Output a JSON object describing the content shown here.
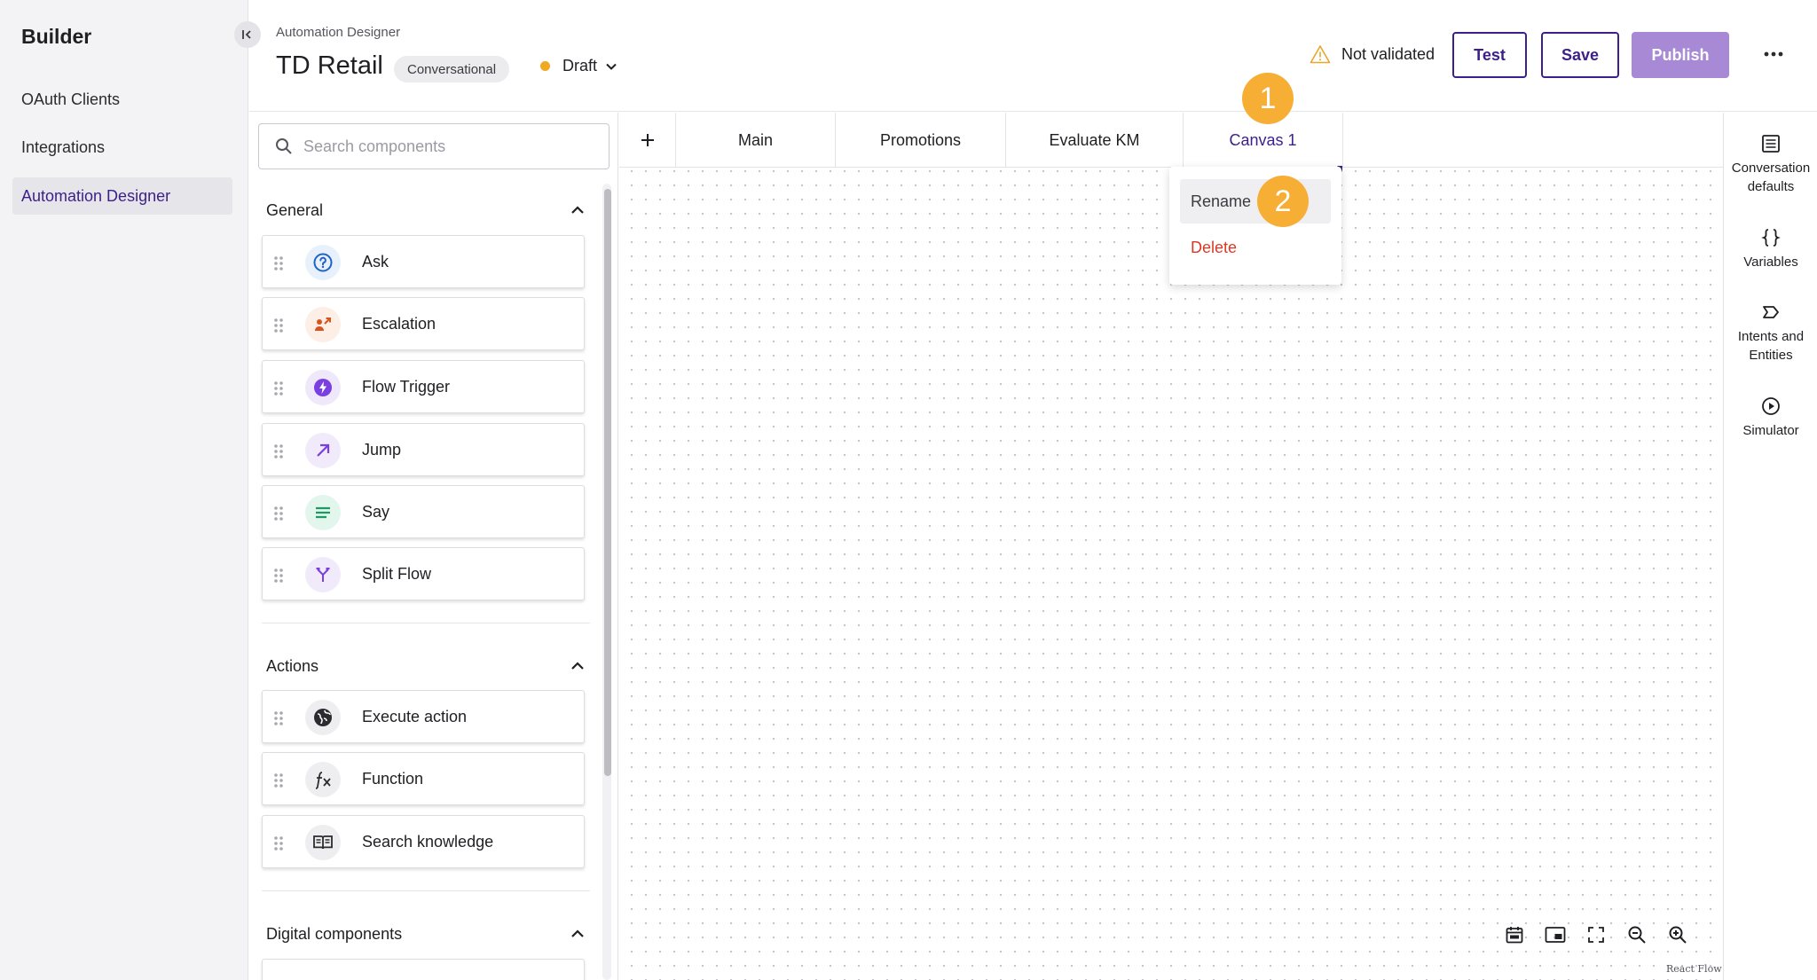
{
  "sidebar": {
    "brand": "Builder",
    "items": [
      {
        "label": "OAuth Clients",
        "active": false
      },
      {
        "label": "Integrations",
        "active": false
      },
      {
        "label": "Automation Designer",
        "active": true
      }
    ]
  },
  "header": {
    "breadcrumb": "Automation Designer",
    "title": "TD Retail",
    "type_badge": "Conversational",
    "status": "Draft",
    "status_color": "#f1a823",
    "validation": "Not validated",
    "test_label": "Test",
    "save_label": "Save",
    "publish_label": "Publish"
  },
  "components_panel": {
    "search_placeholder": "Search components",
    "sections": [
      {
        "title": "General",
        "items": [
          {
            "label": "Ask",
            "icon": "question-icon"
          },
          {
            "label": "Escalation",
            "icon": "escalation-icon"
          },
          {
            "label": "Flow Trigger",
            "icon": "bolt-icon"
          },
          {
            "label": "Jump",
            "icon": "arrow-up-right-icon"
          },
          {
            "label": "Say",
            "icon": "lines-icon"
          },
          {
            "label": "Split Flow",
            "icon": "split-icon"
          }
        ]
      },
      {
        "title": "Actions",
        "items": [
          {
            "label": "Execute action",
            "icon": "globe-icon"
          },
          {
            "label": "Function",
            "icon": "function-icon"
          },
          {
            "label": "Search knowledge",
            "icon": "book-icon"
          }
        ]
      },
      {
        "title": "Digital components",
        "items": []
      }
    ]
  },
  "tabs": [
    {
      "label": "Main"
    },
    {
      "label": "Promotions"
    },
    {
      "label": "Evaluate KM"
    },
    {
      "label": "Canvas 1",
      "active": true
    }
  ],
  "tab_menu": {
    "rename": "Rename",
    "delete": "Delete"
  },
  "steps": [
    "1",
    "2"
  ],
  "right_rail": {
    "items": [
      {
        "label": "Conversation defaults",
        "icon": "list-icon"
      },
      {
        "label": "Variables",
        "icon": "braces-icon"
      },
      {
        "label": "Intents and Entities",
        "icon": "intent-icon"
      },
      {
        "label": "Simulator",
        "icon": "play-icon"
      }
    ]
  },
  "canvas": {
    "attribution": "React Flow"
  },
  "colors": {
    "accent": "#3c1f8a",
    "publish": "#a889d6",
    "step_badge": "#f6ae35",
    "delete": "#d93a26"
  }
}
